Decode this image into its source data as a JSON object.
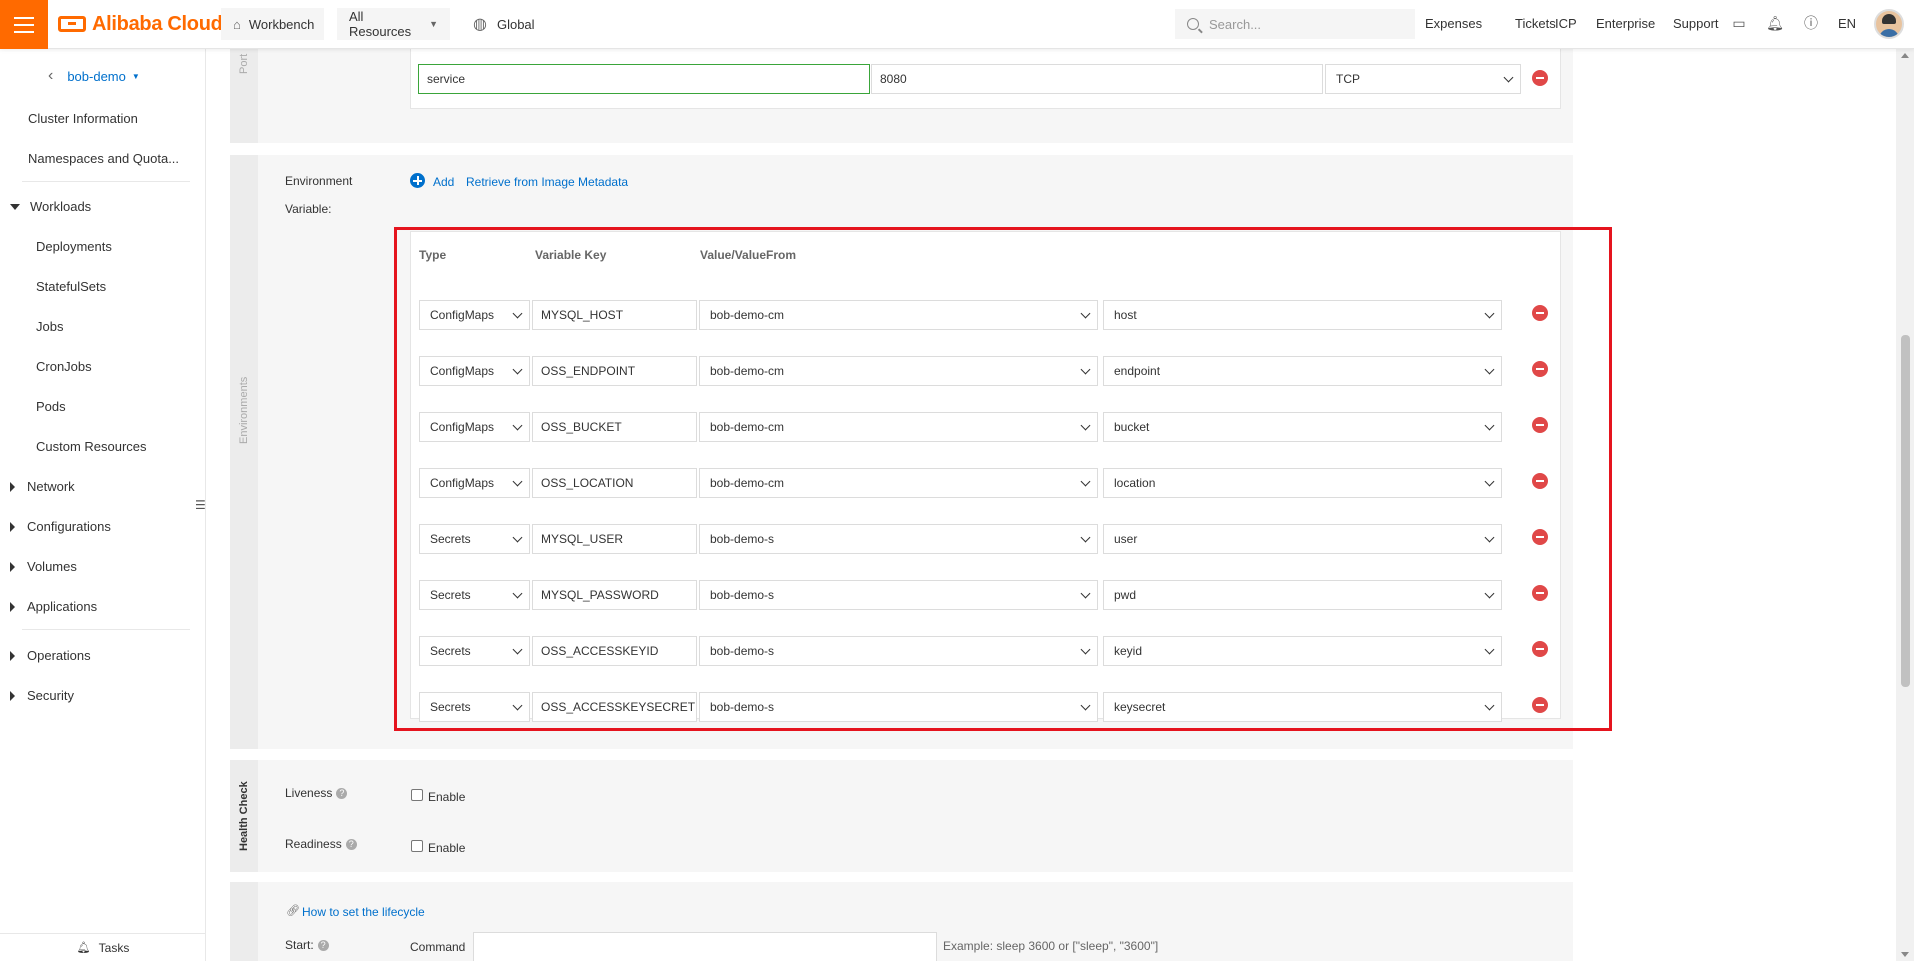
{
  "topbar": {
    "logo_text": "Alibaba Cloud",
    "workbench": "Workbench",
    "all_resources": "All Resources",
    "region": "Global",
    "search_placeholder": "Search...",
    "links": [
      "Expenses",
      "Tickets",
      "ICP",
      "Enterprise",
      "Support"
    ],
    "language": "EN",
    "brand_color": "#ff6a00"
  },
  "sidebar": {
    "cluster_name": "bob-demo",
    "items": {
      "cluster_info": "Cluster Information",
      "namespaces": "Namespaces and Quota...",
      "workloads": "Workloads",
      "deployments": "Deployments",
      "statefulsets": "StatefulSets",
      "jobs": "Jobs",
      "cronjobs": "CronJobs",
      "pods": "Pods",
      "custom_resources": "Custom Resources",
      "network": "Network",
      "configurations": "Configurations",
      "volumes": "Volumes",
      "applications": "Applications",
      "operations": "Operations",
      "security": "Security"
    },
    "footer": "Tasks"
  },
  "ports": {
    "section_label": "Port",
    "name": "service",
    "port": "8080",
    "protocol": "TCP"
  },
  "environments": {
    "section_label": "Environments",
    "label_line1": "Environment",
    "label_line2": "Variable:",
    "add_label": "Add",
    "retrieve_label": "Retrieve from Image Metadata",
    "headers": {
      "type": "Type",
      "key": "Variable Key",
      "value": "Value/ValueFrom"
    },
    "rows": [
      {
        "type": "ConfigMaps",
        "key": "MYSQL_HOST",
        "source": "bob-demo-cm",
        "item": "host"
      },
      {
        "type": "ConfigMaps",
        "key": "OSS_ENDPOINT",
        "source": "bob-demo-cm",
        "item": "endpoint"
      },
      {
        "type": "ConfigMaps",
        "key": "OSS_BUCKET",
        "source": "bob-demo-cm",
        "item": "bucket"
      },
      {
        "type": "ConfigMaps",
        "key": "OSS_LOCATION",
        "source": "bob-demo-cm",
        "item": "location"
      },
      {
        "type": "Secrets",
        "key": "MYSQL_USER",
        "source": "bob-demo-s",
        "item": "user"
      },
      {
        "type": "Secrets",
        "key": "MYSQL_PASSWORD",
        "source": "bob-demo-s",
        "item": "pwd"
      },
      {
        "type": "Secrets",
        "key": "OSS_ACCESSKEYID",
        "source": "bob-demo-s",
        "item": "keyid"
      },
      {
        "type": "Secrets",
        "key": "OSS_ACCESSKEYSECRET",
        "source": "bob-demo-s",
        "item": "keysecret"
      }
    ]
  },
  "health_check": {
    "section_label": "Health Check",
    "liveness": "Liveness",
    "readiness": "Readiness",
    "enable": "Enable"
  },
  "lifecycle": {
    "link": "How to set the lifecycle",
    "start": "Start:",
    "command": "Command",
    "hint": "Example: sleep 3600 or [\"sleep\", \"3600\"]"
  }
}
